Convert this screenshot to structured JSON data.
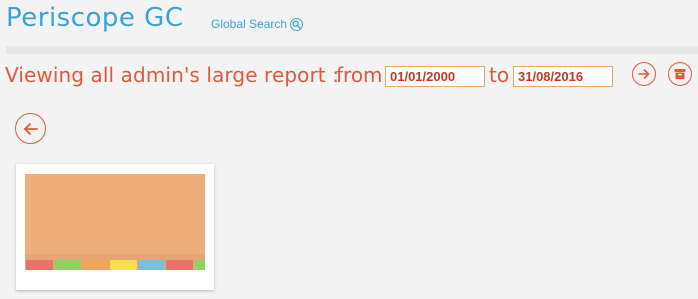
{
  "header": {
    "app_title": "Periscope GC",
    "global_search_label": "Global Search"
  },
  "report": {
    "title": "Viewing all admin's large report :",
    "from_label": "from",
    "to_label": "to",
    "date_from": "01/01/2000",
    "date_to": "31/08/2016"
  },
  "actions": {
    "go_icon": "arrow-right-icon",
    "archive_icon": "archive-box-icon",
    "back_icon": "arrow-left-icon"
  },
  "thumbnail": {
    "icon": "folder-tabs-thumbnail",
    "colors": {
      "paper": "#eeae7c",
      "tabs": [
        "#e8736b",
        "#8fd163",
        "#f2a35c",
        "#f6e04a",
        "#7cc0d8",
        "#e8736b",
        "#8fd163"
      ]
    }
  },
  "colors": {
    "brand": "#3aa4d4",
    "accent": "#e05a3a",
    "background": "#f3f3f3"
  }
}
